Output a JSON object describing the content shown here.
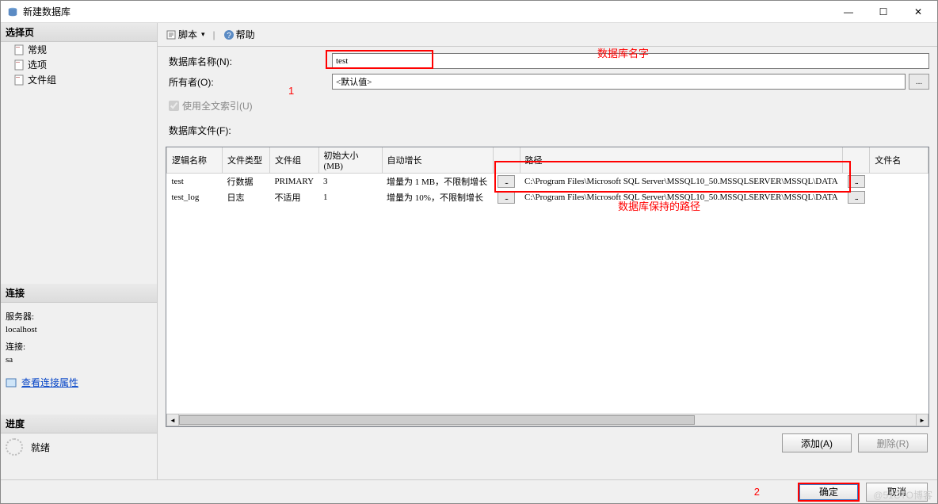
{
  "window": {
    "title": "新建数据库"
  },
  "winctrl": {
    "min": "—",
    "max": "☐",
    "close": "✕"
  },
  "sidebar": {
    "select_header": "选择页",
    "items": [
      "常规",
      "选项",
      "文件组"
    ],
    "conn_header": "连接",
    "server_label": "服务器:",
    "server_value": "localhost",
    "connection_label": "连接:",
    "connection_value": "sa",
    "view_props": "查看连接属性",
    "progress_header": "进度",
    "progress_status": "就绪"
  },
  "toolbar": {
    "script": "脚本",
    "dropdown": "▼",
    "help": "帮助",
    "sep": "▾"
  },
  "form": {
    "db_name_label": "数据库名称(N):",
    "db_name_value": "test",
    "owner_label": "所有者(O):",
    "owner_value": "<默认值>",
    "browse": "...",
    "fulltext": "使用全文索引(U)",
    "files_label": "数据库文件(F):"
  },
  "annotations": {
    "a1": "数据库名字",
    "n1": "1",
    "a2": "数据库保持的路径",
    "n2": "2"
  },
  "grid": {
    "headers": [
      "逻辑名称",
      "文件类型",
      "文件组",
      "初始大小(MB)",
      "自动增长",
      "",
      "路径",
      "",
      "文件名"
    ],
    "rows": [
      {
        "name": "test",
        "ftype": "行数据",
        "fgroup": "PRIMARY",
        "size": "3",
        "growth": "增量为 1 MB，不限制增长",
        "path": "C:\\Program Files\\Microsoft SQL Server\\MSSQL10_50.MSSQLSERVER\\MSSQL\\DATA",
        "fname": ""
      },
      {
        "name": "test_log",
        "ftype": "日志",
        "fgroup": "不适用",
        "size": "1",
        "growth": "增量为 10%，不限制增长",
        "path": "C:\\Program Files\\Microsoft SQL Server\\MSSQL10_50.MSSQLSERVER\\MSSQL\\DATA",
        "fname": ""
      }
    ]
  },
  "actions": {
    "add": "添加(A)",
    "remove": "删除(R)"
  },
  "footer": {
    "ok": "确定",
    "cancel": "取消"
  },
  "watermark": "@51CTO博客"
}
